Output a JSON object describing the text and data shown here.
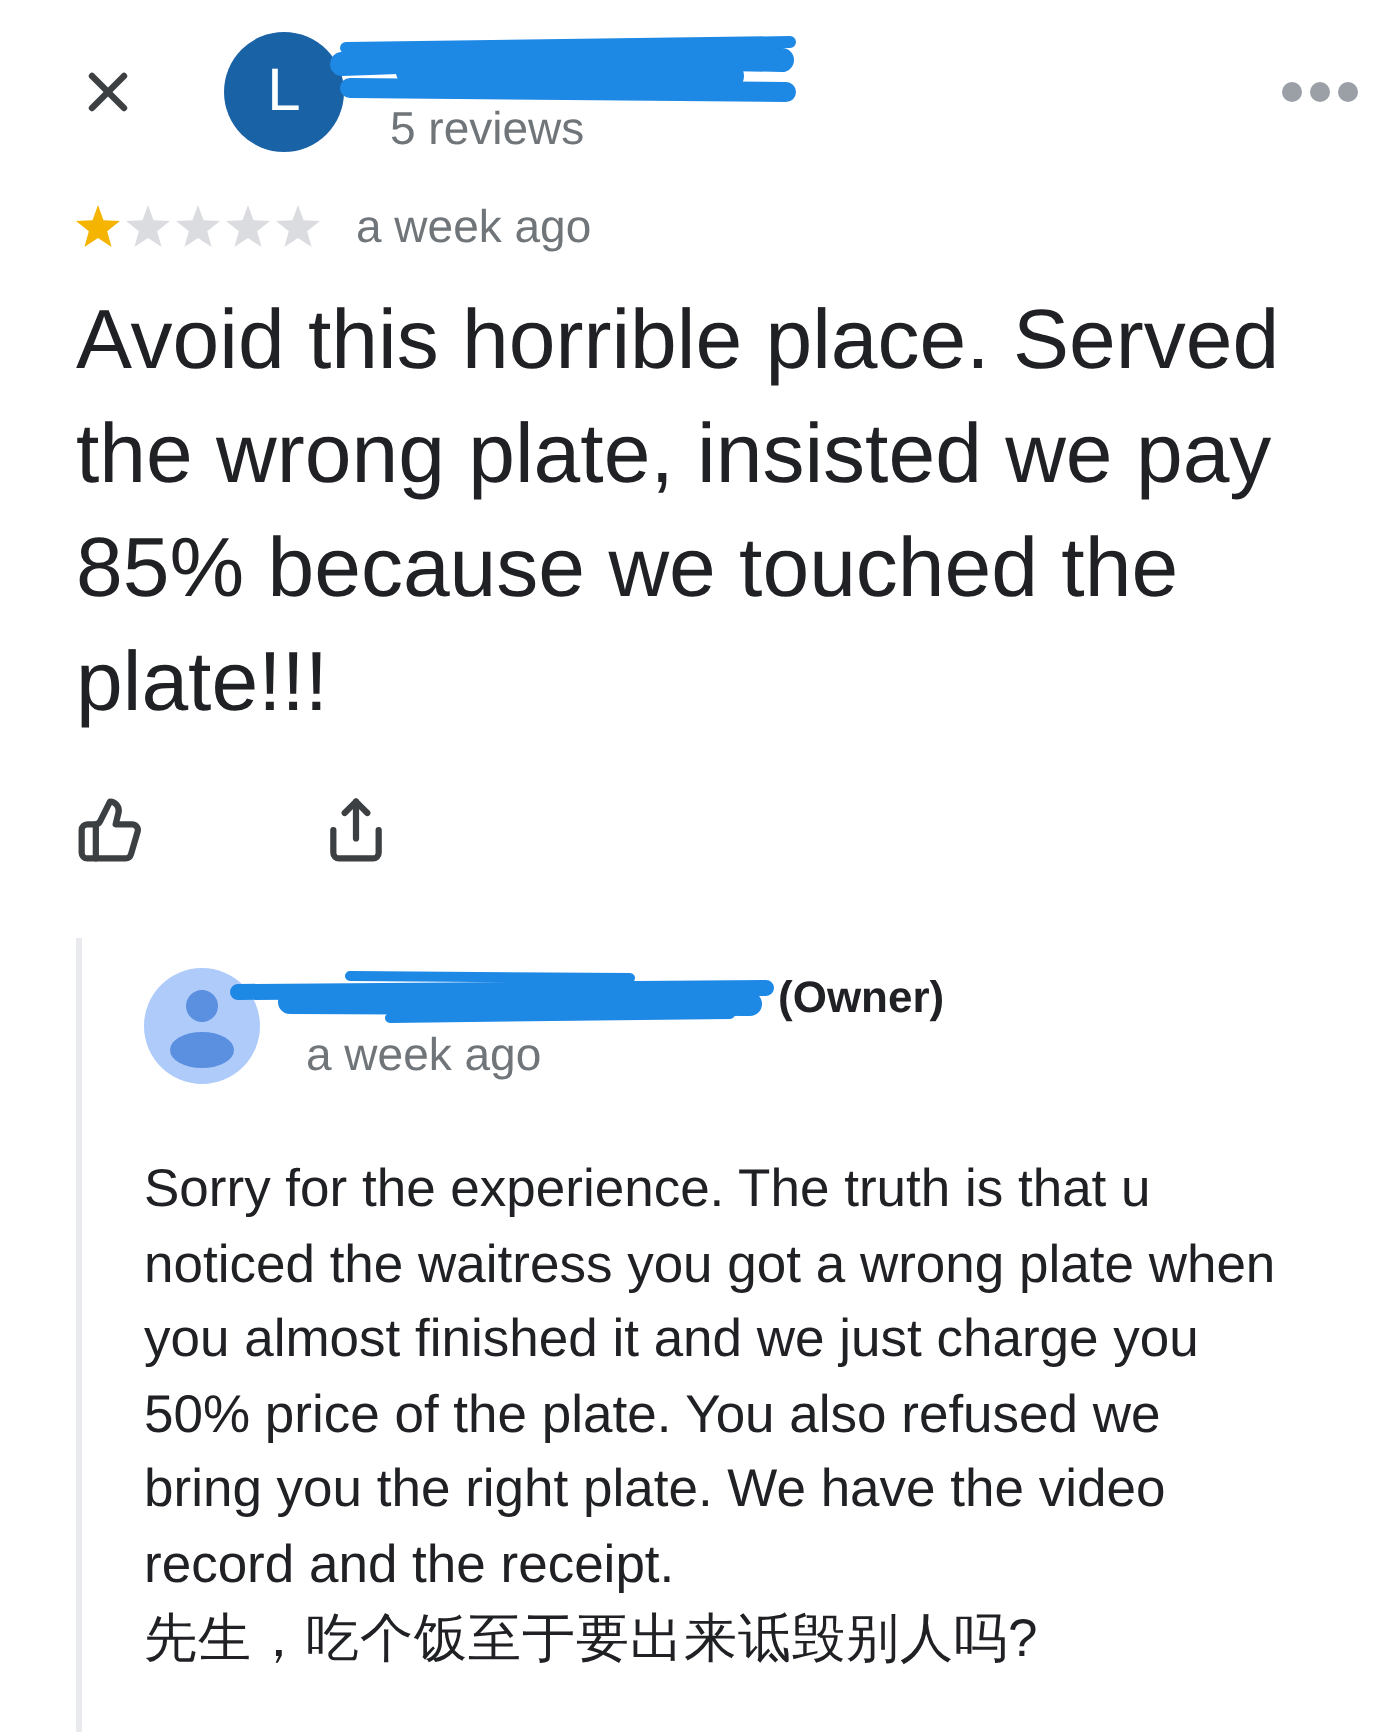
{
  "header": {
    "avatar_letter": "L",
    "reviews": "5 reviews"
  },
  "review": {
    "stars": 1,
    "time": "a week ago",
    "lines": [
      "Avoid this horrible place. Served",
      "the wrong plate, insisted we pay",
      "85% because we touched the",
      "plate!!!"
    ]
  },
  "reply": {
    "owner_label": "(Owner)",
    "time": "a week ago",
    "lines": [
      "Sorry for the experience. The truth is that u",
      "noticed the waitress you got a wrong plate when",
      "you almost finished it and we just charge you",
      "50% price of the plate. You also refused we",
      "bring you the right plate. We have the video",
      "record and the receipt.",
      "先生，吃个饭至于要出来诋毁别人吗?"
    ]
  }
}
